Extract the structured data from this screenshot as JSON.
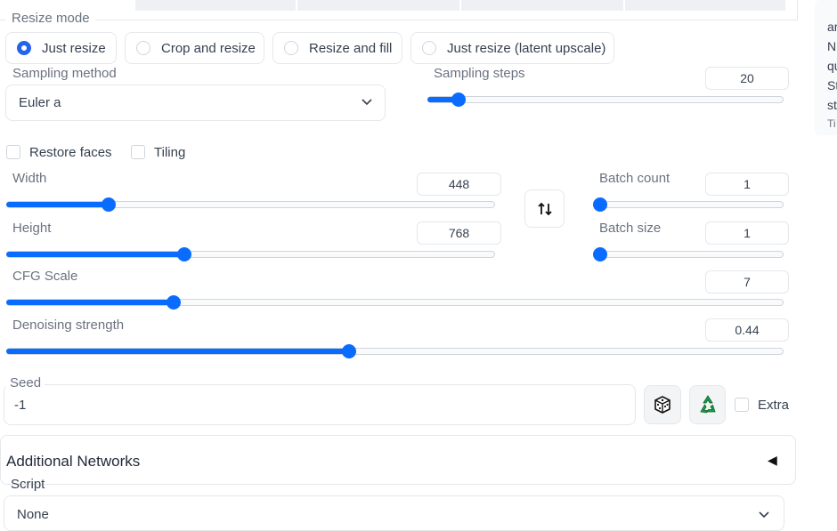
{
  "resize_mode": {
    "label": "Resize mode",
    "options": [
      "Just resize",
      "Crop and resize",
      "Resize and fill",
      "Just resize (latent upscale)"
    ],
    "selected": "Just resize"
  },
  "sampling_method": {
    "label": "Sampling method",
    "value": "Euler a"
  },
  "sampling_steps": {
    "label": "Sampling steps",
    "value": "20",
    "fraction": 0.07
  },
  "checkboxes": {
    "restore_faces": "Restore faces",
    "tiling": "Tiling"
  },
  "width": {
    "label": "Width",
    "value": "448",
    "fraction": 0.2
  },
  "height": {
    "label": "Height",
    "value": "768",
    "fraction": 0.36
  },
  "swap_icon": "swap-vertical-arrows-icon",
  "batch_count": {
    "label": "Batch count",
    "value": "1",
    "fraction": 0
  },
  "batch_size": {
    "label": "Batch size",
    "value": "1",
    "fraction": 0
  },
  "cfg_scale": {
    "label": "CFG Scale",
    "value": "7",
    "fraction": 0.21
  },
  "denoising": {
    "label": "Denoising strength",
    "value": "0.44",
    "fraction": 0.44
  },
  "seed": {
    "label": "Seed",
    "value": "-1",
    "extra_label": "Extra"
  },
  "additional_networks": {
    "label": "Additional Networks",
    "toggle": "◀"
  },
  "script": {
    "label": "Script",
    "value": "None"
  },
  "side_panel_lines": [
    "ar",
    "N",
    "qu",
    "St",
    "st",
    "Ti"
  ],
  "colors": {
    "accent": "#0a6cff",
    "border": "#e5e7eb",
    "recycle": "#16a34a"
  }
}
